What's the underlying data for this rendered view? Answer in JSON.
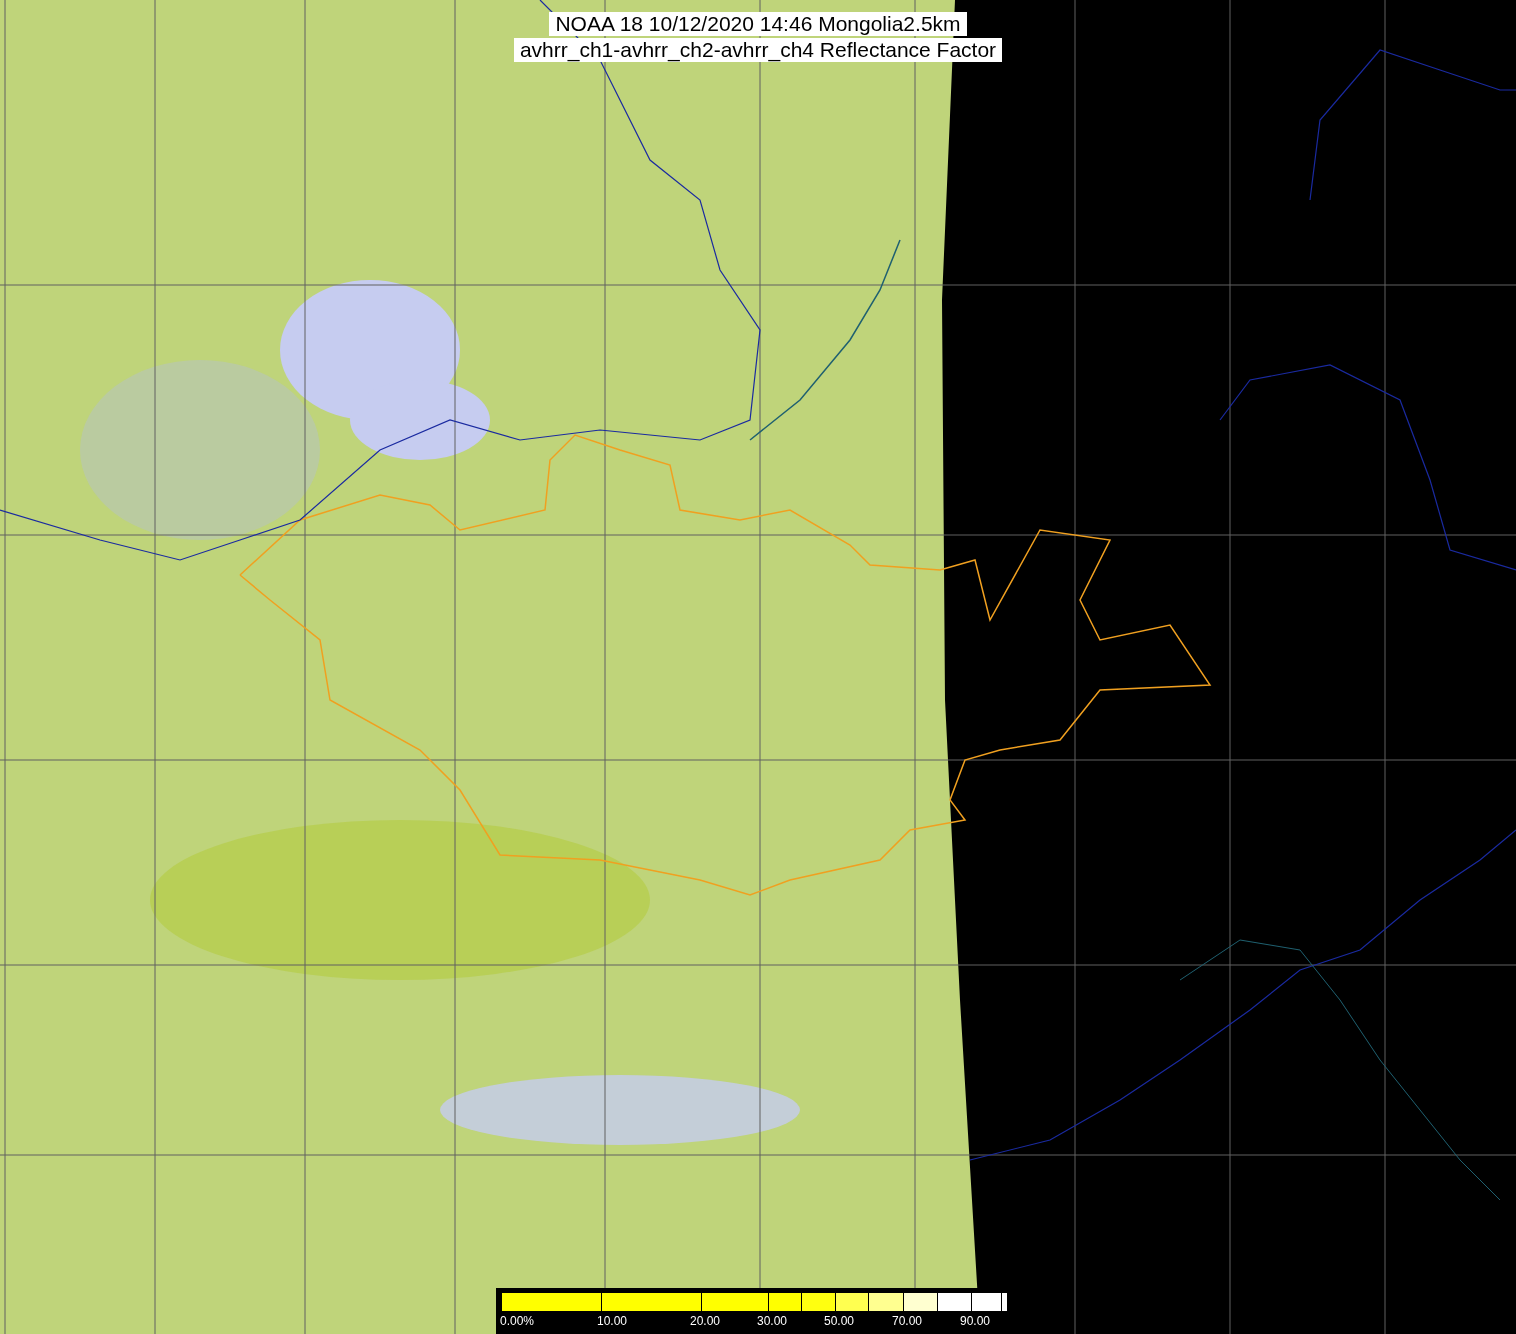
{
  "title": {
    "lines": [
      "NOAA 18 10/12/2020 14:46 Mongolia2.5km",
      "avhrr_ch1-avhrr_ch2-avhrr_ch4 Reflectance Factor"
    ]
  },
  "colorbar": {
    "segments": [
      {
        "color": "#ffff00"
      },
      {
        "color": "#ffff00"
      },
      {
        "color": "#ffff00"
      },
      {
        "color": "#ffff00"
      },
      {
        "color": "#ffff10"
      },
      {
        "color": "#ffff50"
      },
      {
        "color": "#ffff90"
      },
      {
        "color": "#ffffd0"
      },
      {
        "color": "#ffffff"
      },
      {
        "color": "#ffffff"
      },
      {
        "color": "#ffffff"
      }
    ],
    "ticks": [
      "0.00%",
      "10.00",
      "20.00",
      "30.00",
      "50.00",
      "70.00",
      "90.00"
    ]
  }
}
